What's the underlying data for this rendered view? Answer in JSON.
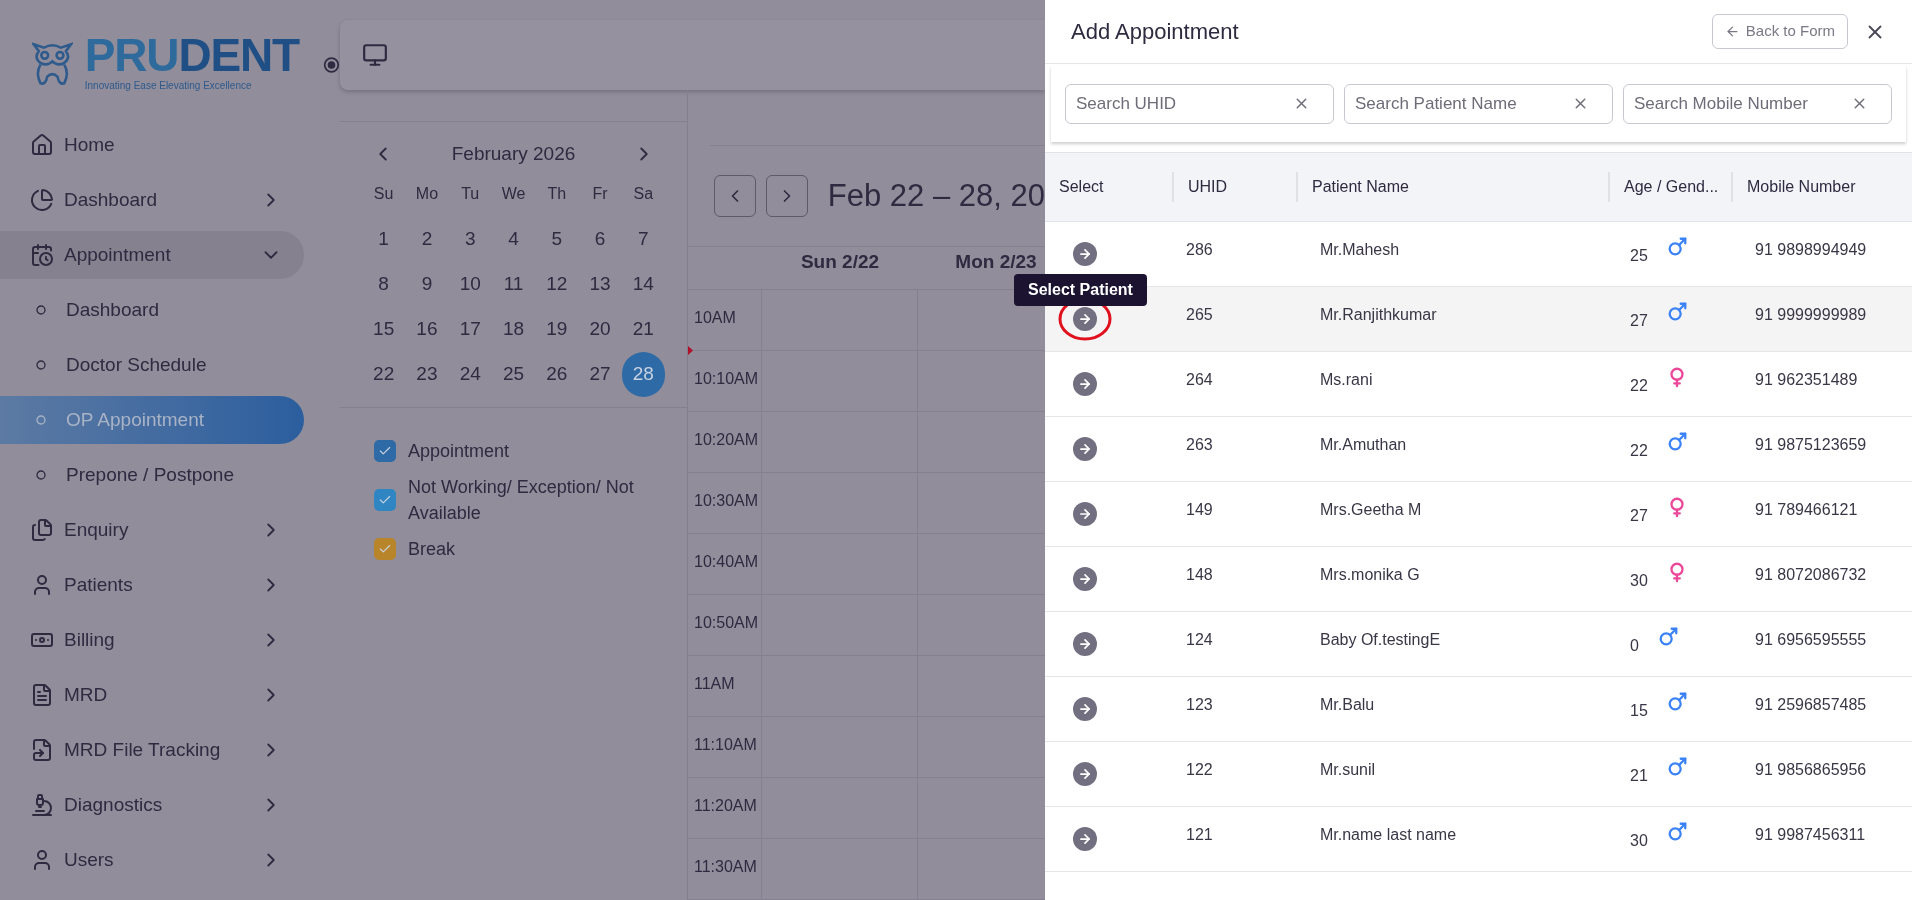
{
  "sidebar": {
    "brand": {
      "name_light": "PRU",
      "name_dark": "DENT",
      "tagline": "Innovating Ease Elevating Excellence"
    },
    "items": [
      {
        "label": "Home",
        "expandable": false,
        "expanded": false
      },
      {
        "label": "Dashboard",
        "expandable": true,
        "expanded": false
      },
      {
        "label": "Appointment",
        "expandable": true,
        "expanded": true,
        "children": [
          {
            "label": "Dashboard",
            "selected": false
          },
          {
            "label": "Doctor Schedule",
            "selected": false
          },
          {
            "label": "OP Appointment",
            "selected": true
          },
          {
            "label": "Prepone / Postpone",
            "selected": false
          }
        ]
      },
      {
        "label": "Enquiry",
        "expandable": true,
        "expanded": false
      },
      {
        "label": "Patients",
        "expandable": true,
        "expanded": false
      },
      {
        "label": "Billing",
        "expandable": true,
        "expanded": false
      },
      {
        "label": "MRD",
        "expandable": true,
        "expanded": false
      },
      {
        "label": "MRD File Tracking",
        "expandable": true,
        "expanded": false
      },
      {
        "label": "Diagnostics",
        "expandable": true,
        "expanded": false
      },
      {
        "label": "Users",
        "expandable": true,
        "expanded": false
      }
    ]
  },
  "calendar": {
    "month": "February 2026",
    "weekdays": [
      "Su",
      "Mo",
      "Tu",
      "We",
      "Th",
      "Fr",
      "Sa"
    ],
    "weeks": [
      [
        {
          "label": "1",
          "selected": false
        },
        {
          "label": "2",
          "selected": false
        },
        {
          "label": "3",
          "selected": false
        },
        {
          "label": "4",
          "selected": false
        },
        {
          "label": "5",
          "selected": false
        },
        {
          "label": "6",
          "selected": false
        },
        {
          "label": "7",
          "selected": false
        }
      ],
      [
        {
          "label": "8",
          "selected": false
        },
        {
          "label": "9",
          "selected": false
        },
        {
          "label": "10",
          "selected": false
        },
        {
          "label": "11",
          "selected": false
        },
        {
          "label": "12",
          "selected": false
        },
        {
          "label": "13",
          "selected": false
        },
        {
          "label": "14",
          "selected": false
        }
      ],
      [
        {
          "label": "15",
          "selected": false
        },
        {
          "label": "16",
          "selected": false
        },
        {
          "label": "17",
          "selected": false
        },
        {
          "label": "18",
          "selected": false
        },
        {
          "label": "19",
          "selected": false
        },
        {
          "label": "20",
          "selected": false
        },
        {
          "label": "21",
          "selected": false
        }
      ],
      [
        {
          "label": "22",
          "selected": false
        },
        {
          "label": "23",
          "selected": false
        },
        {
          "label": "24",
          "selected": false
        },
        {
          "label": "25",
          "selected": false
        },
        {
          "label": "26",
          "selected": false
        },
        {
          "label": "27",
          "selected": false
        },
        {
          "label": "28",
          "selected": true
        }
      ]
    ],
    "legend": [
      {
        "label": "Appointment",
        "checked": true,
        "color": "#2e6aa6"
      },
      {
        "label": "Not Working/ Exception/ Not Available",
        "checked": true,
        "color": "#2f86c2"
      },
      {
        "label": "Break",
        "checked": true,
        "color": "#b8852a"
      }
    ]
  },
  "schedule": {
    "range_title": "Feb 22 – 28, 20",
    "days": [
      "Sun 2/22",
      "Mon 2/23"
    ],
    "times": [
      "10AM",
      "10:10AM",
      "10:20AM",
      "10:30AM",
      "10:40AM",
      "10:50AM",
      "11AM",
      "11:10AM",
      "11:20AM",
      "11:30AM"
    ]
  },
  "panel": {
    "title": "Add Appointment",
    "back_button": "Back to Form",
    "searches": [
      {
        "placeholder": "Search UHID"
      },
      {
        "placeholder": "Search Patient Name"
      },
      {
        "placeholder": "Search Mobile Number"
      }
    ],
    "columns": [
      "Select",
      "UHID",
      "Patient Name",
      "Age / Gend...",
      "Mobile Number"
    ],
    "tooltip": "Select Patient",
    "rows": [
      {
        "uhid": "286",
        "name": "Mr.Mahesh",
        "age": "25",
        "kind": "male",
        "mobile": "91 9898994949",
        "selected": false
      },
      {
        "uhid": "265",
        "name": "Mr.Ranjithkumar",
        "age": "27",
        "kind": "male",
        "mobile": "91 9999999989",
        "selected": true
      },
      {
        "uhid": "264",
        "name": "Ms.rani",
        "age": "22",
        "kind": "female",
        "mobile": "91 962351489",
        "selected": false
      },
      {
        "uhid": "263",
        "name": "Mr.Amuthan",
        "age": "22",
        "kind": "male",
        "mobile": "91 9875123659",
        "selected": false
      },
      {
        "uhid": "149",
        "name": "Mrs.Geetha M",
        "age": "27",
        "kind": "female",
        "mobile": "91 789466121",
        "selected": false
      },
      {
        "uhid": "148",
        "name": "Mrs.monika G",
        "age": "30",
        "kind": "female",
        "mobile": "91 8072086732",
        "selected": false
      },
      {
        "uhid": "124",
        "name": "Baby Of.testingE",
        "age": "0",
        "kind": "male",
        "mobile": "91 6956595555",
        "selected": false
      },
      {
        "uhid": "123",
        "name": "Mr.Balu",
        "age": "15",
        "kind": "male",
        "mobile": "91 2596857485",
        "selected": false
      },
      {
        "uhid": "122",
        "name": "Mr.sunil",
        "age": "21",
        "kind": "male",
        "mobile": "91 9856865956",
        "selected": false
      },
      {
        "uhid": "121",
        "name": "Mr.name last name",
        "age": "30",
        "kind": "male",
        "mobile": "91 9987456311",
        "selected": false
      }
    ]
  }
}
